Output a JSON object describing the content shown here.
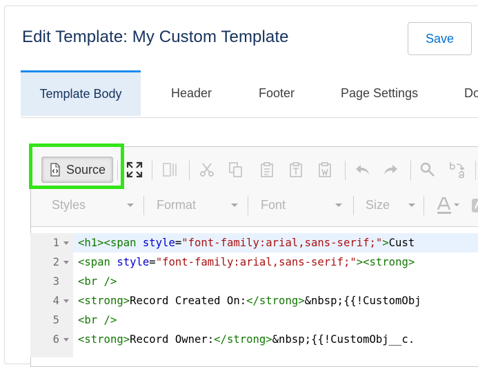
{
  "page": {
    "title": "Edit Template: My Custom Template",
    "save_label": "Save"
  },
  "tabs": [
    {
      "label": "Template Body",
      "active": true
    },
    {
      "label": "Header"
    },
    {
      "label": "Footer"
    },
    {
      "label": "Page Settings"
    },
    {
      "label": "Do"
    }
  ],
  "toolbar": {
    "source_label": "Source",
    "highlight_color": "#33e517",
    "icons": [
      "maximize-icon",
      "show-blocks-icon",
      "cut-icon",
      "copy-icon",
      "paste-icon",
      "paste-text-icon",
      "paste-word-icon",
      "undo-icon",
      "redo-icon",
      "find-icon",
      "replace-icon"
    ],
    "combos": [
      {
        "label": "Styles"
      },
      {
        "label": "Format"
      },
      {
        "label": "Font"
      },
      {
        "label": "Size"
      }
    ]
  },
  "code": {
    "lines": [
      {
        "num": "1",
        "fold": true,
        "html": "<span class='tg'>&lt;h1&gt;&lt;span</span> <span class='at'>style</span>=<span class='st'>\"font-family:arial,sans-serif;\"</span><span class='tg'>&gt;</span>Cust"
      },
      {
        "num": "2",
        "fold": true,
        "html": "<span class='tg'>&lt;span</span> <span class='at'>style</span>=<span class='st'>\"font-family:arial,sans-serif;\"</span><span class='tg'>&gt;&lt;strong&gt;</span>"
      },
      {
        "num": "3",
        "fold": false,
        "html": "<span class='tg'>&lt;br /&gt;</span>"
      },
      {
        "num": "4",
        "fold": true,
        "html": "<span class='tg'>&lt;strong&gt;</span>Record Created On:<span class='tg'>&lt;/strong&gt;</span>&amp;nbsp;{{!CustomObj"
      },
      {
        "num": "5",
        "fold": false,
        "html": "<span class='tg'>&lt;br /&gt;</span>"
      },
      {
        "num": "6",
        "fold": true,
        "html": "<span class='tg'>&lt;strong&gt;</span>Record Owner:<span class='tg'>&lt;/strong&gt;</span>&amp;nbsp;{{!CustomObj__c."
      }
    ]
  }
}
